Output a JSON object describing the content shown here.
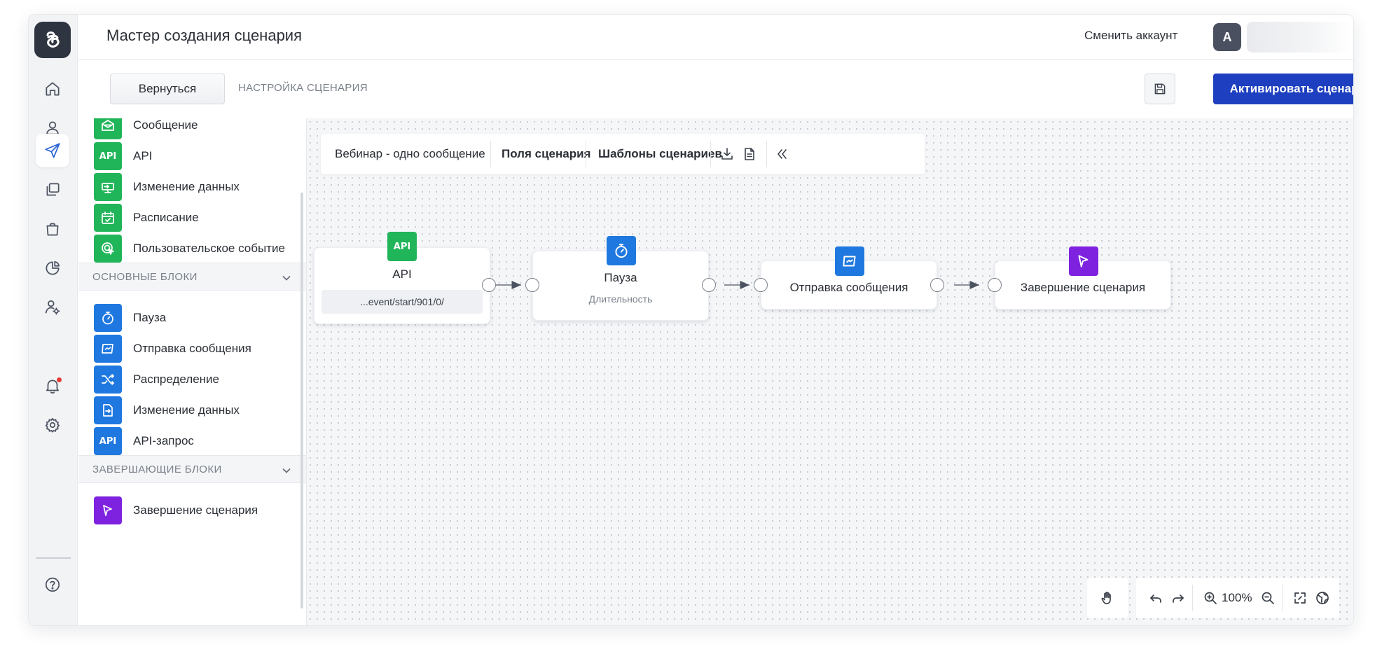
{
  "header": {
    "title": "Мастер создания сценария",
    "switch_account": "Сменить аккаунт",
    "avatar_letter": "А"
  },
  "subheader": {
    "back_label": "Вернуться",
    "breadcrumb": "НАСТРОЙКА СЦЕНАРИЯ",
    "activate_label": "Активировать сценарий"
  },
  "rail": {
    "items": [
      "home-icon",
      "user-icon",
      "send-icon",
      "copy-icon",
      "bag-icon",
      "pie-chart-icon",
      "user-settings-icon"
    ],
    "active": "send-icon",
    "bottom": [
      "bell-icon",
      "gear-icon",
      "help-icon"
    ]
  },
  "panel": {
    "start_blocks": [
      {
        "label": "Сообщение",
        "icon": "message-icon"
      },
      {
        "label": "API",
        "icon": "api-icon"
      },
      {
        "label": "Изменение данных",
        "icon": "data-change-icon"
      },
      {
        "label": "Расписание",
        "icon": "calendar-icon"
      },
      {
        "label": "Пользовательское событие",
        "icon": "custom-event-icon"
      }
    ],
    "main_section": "ОСНОВНЫЕ БЛОКИ",
    "main_blocks": [
      {
        "label": "Пауза",
        "icon": "timer-icon"
      },
      {
        "label": "Отправка сообщения",
        "icon": "send-message-icon"
      },
      {
        "label": "Распределение",
        "icon": "shuffle-icon"
      },
      {
        "label": "Изменение данных",
        "icon": "edit-data-icon"
      },
      {
        "label": "API-запрос",
        "icon": "api-icon"
      }
    ],
    "final_section": "ЗАВЕРШАЮЩИЕ БЛОКИ",
    "final_blocks": [
      {
        "label": "Завершение сценария",
        "icon": "flag-icon"
      }
    ]
  },
  "toolbar": {
    "scenario_name": "Вебинар - одно сообщение",
    "fields": "Поля сценария",
    "templates": "Шаблоны сценариев"
  },
  "api_badge": "API",
  "flow": {
    "nodes": [
      {
        "title": "API",
        "detail": "...event/start/901/0/",
        "icon": "api-icon",
        "color": "#21b55a"
      },
      {
        "title": "Пауза",
        "detail": "Длительность",
        "icon": "timer-icon",
        "color": "#1f78df"
      },
      {
        "title": "Отправка сообщения",
        "icon": "send-message-icon",
        "color": "#1f78df"
      },
      {
        "title": "Завершение сценария",
        "icon": "flag-icon",
        "color": "#7e22e0"
      }
    ]
  },
  "zoom": {
    "level": "100%"
  },
  "colors": {
    "primary": "#1e3fbf",
    "green": "#21b55a",
    "blue": "#1f78df",
    "purple": "#7e22e0",
    "notification": "#e53935"
  }
}
